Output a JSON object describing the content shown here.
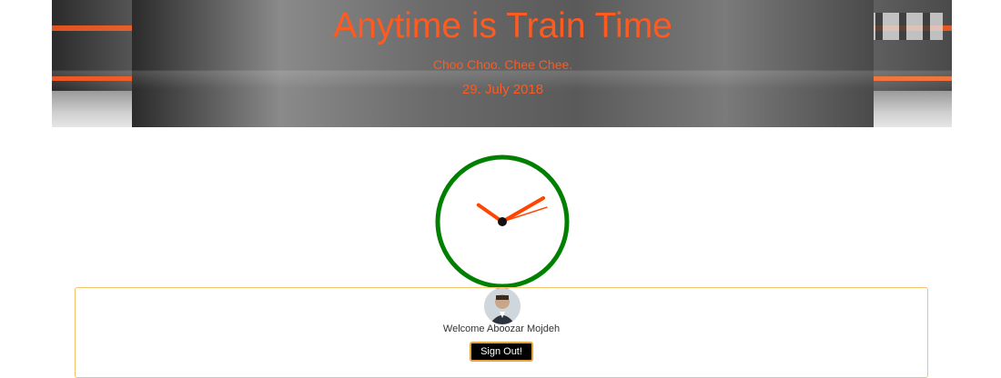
{
  "header": {
    "title": "Anytime is Train Time",
    "subtitle": "Choo Choo. Chee Chee.",
    "date": "29. July 2018",
    "accent_color": "#ff5a1f"
  },
  "clock": {
    "hour": 10,
    "minute": 10,
    "second": 12,
    "face_color": "#008000",
    "hand_color": "#ff4500"
  },
  "user_card": {
    "avatar_icon": "user-avatar",
    "welcome_text": "Welcome Aboozar Mojdeh",
    "sign_out_label": "Sign Out!",
    "border_color": "#f5c36b"
  }
}
